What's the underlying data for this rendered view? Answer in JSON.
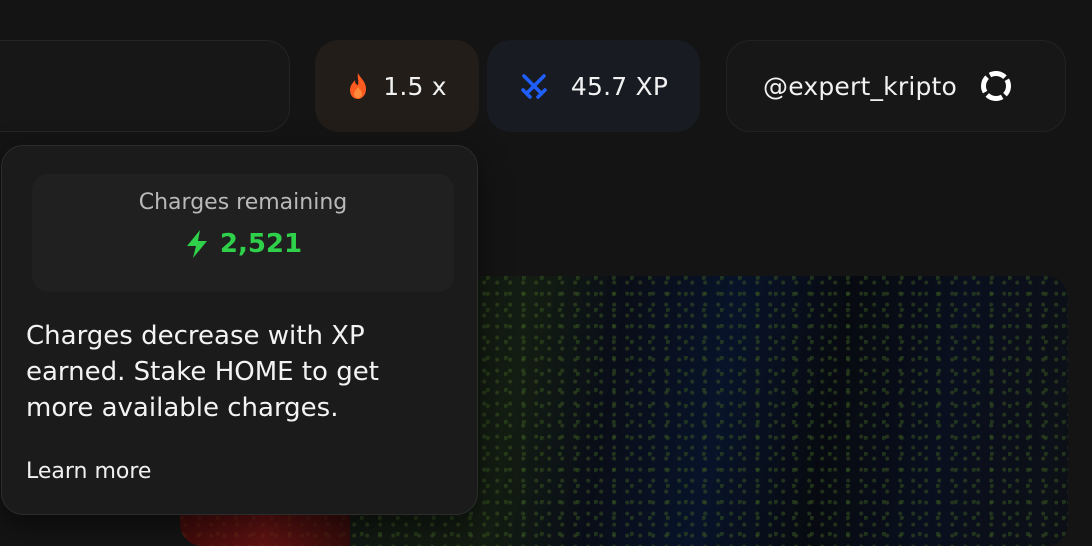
{
  "header": {
    "multiplier": {
      "label": "1.5 x",
      "icon": "flame-icon"
    },
    "xp": {
      "label": "45.7 XP",
      "icon": "crossed-swords-icon"
    },
    "user": {
      "handle": "@expert_kripto",
      "avatar_icon": "ring-avatar-icon"
    }
  },
  "charges_popover": {
    "title": "Charges remaining",
    "value": "2,521",
    "value_icon": "lightning-bolt-icon",
    "description": "Charges decrease with XP earned. Stake HOME to get more available charges.",
    "link": "Learn more"
  },
  "colors": {
    "accent_green": "#2fd14a",
    "flame_orange": "#ff5a1f",
    "swords_blue": "#1f5fff",
    "background": "#141414"
  }
}
